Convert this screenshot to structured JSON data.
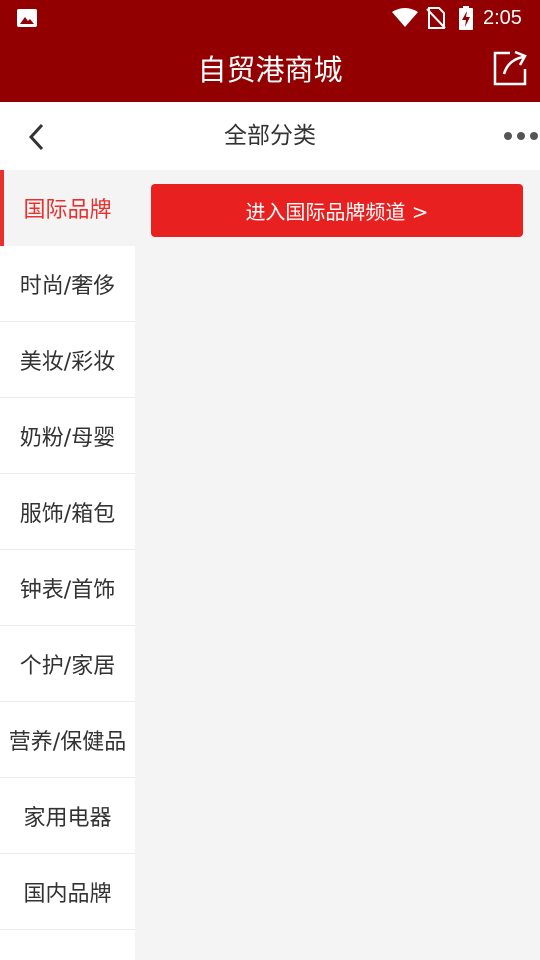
{
  "status_bar": {
    "time": "2:05",
    "icons": [
      "image-icon",
      "wifi-icon",
      "no-sim-icon",
      "battery-charging-icon"
    ]
  },
  "app_bar": {
    "title": "自贸港商城",
    "share_icon": "share-icon"
  },
  "sub_nav": {
    "title": "全部分类",
    "back_icon": "chevron-left-icon",
    "more_icon": "more-dots-icon"
  },
  "sidebar": {
    "items": [
      {
        "label": "国际品牌",
        "active": true
      },
      {
        "label": "时尚/奢侈"
      },
      {
        "label": "美妆/彩妆"
      },
      {
        "label": "奶粉/母婴"
      },
      {
        "label": "服饰/箱包"
      },
      {
        "label": "钟表/首饰"
      },
      {
        "label": "个护/家居"
      },
      {
        "label": "营养/保健品"
      },
      {
        "label": "家用电器"
      },
      {
        "label": "国内品牌"
      }
    ]
  },
  "content": {
    "channel_button": "进入国际品牌频道 >"
  },
  "colors": {
    "header": "#920002",
    "accent": "#e8312f",
    "button": "#e82020"
  }
}
